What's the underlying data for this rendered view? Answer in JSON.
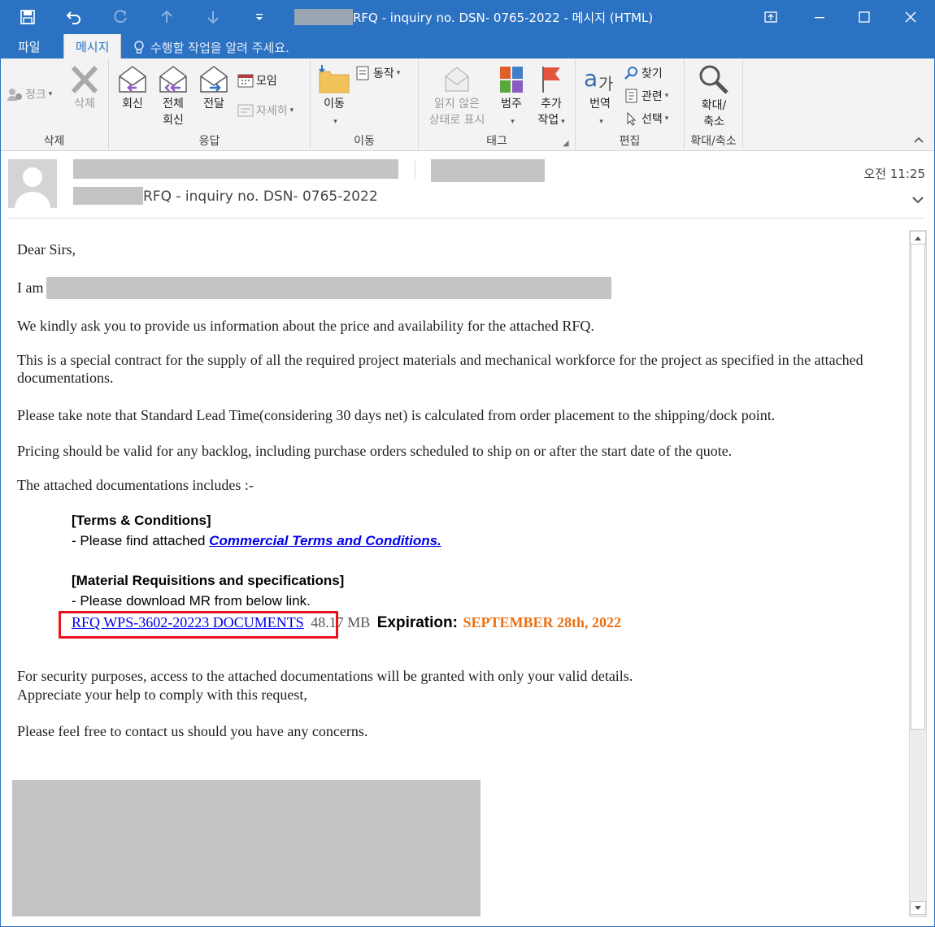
{
  "window": {
    "title": "RFQ - inquiry no. DSN- 0765-2022 - 메시지 (HTML)"
  },
  "tabs": [
    {
      "label": "파일"
    },
    {
      "label": "메시지",
      "active": true
    }
  ],
  "tell_me": {
    "placeholder": "수행할 작업을 알려 주세요."
  },
  "ribbon": {
    "delete_group": {
      "label": "삭제",
      "junk": "정크",
      "delete": "삭제"
    },
    "respond_group": {
      "label": "응답",
      "reply": "회신",
      "reply_all_1": "전체",
      "reply_all_2": "회신",
      "forward": "전달",
      "meeting": "모임",
      "more": "자세히"
    },
    "move_group": {
      "label": "이동",
      "move": "이동",
      "actions": "동작"
    },
    "tags_group": {
      "label": "태그",
      "unread_1": "읽지 않은",
      "unread_2": "상태로 표시",
      "categorize": "범주",
      "followup_1": "추가",
      "followup_2": "작업"
    },
    "edit_group": {
      "label": "편집",
      "translate": "번역",
      "find": "찾기",
      "related": "관련",
      "select": "선택"
    },
    "zoom_group": {
      "label": "확대/축소",
      "zoom_1": "확대/",
      "zoom_2": "축소"
    }
  },
  "header": {
    "subject": "RFQ - inquiry no. DSN- 0765-2022",
    "time": "오전 11:25"
  },
  "body": {
    "greeting": "Dear Sirs,",
    "intro": "I am",
    "p1": "We kindly ask you to provide us information about the price and availability for the attached RFQ.",
    "p2": "This is a special contract for the supply of all the required project materials and mechanical workforce for the project as specified in the attached documentations.",
    "p3": "Please take note that Standard Lead Time(considering 30 days net) is calculated from order placement to the shipping/dock point.",
    "p4": "Pricing should be valid for any backlog, including purchase orders scheduled to ship on or after the start date of the quote.",
    "p5": "The attached documentations includes :-",
    "terms_heading": "[Terms & Conditions]",
    "terms_prefix": "- Please find attached ",
    "terms_link": "Commercial Terms and Conditions.",
    "mr_heading": "[Material Requisitions and specifications]",
    "mr_text": "- Please download MR from below link.",
    "doc_link": "RFQ WPS-3602-20223 DOCUMENTS",
    "doc_size": "48.17 MB",
    "expiration_label": "Expiration:",
    "expiration_date": "SEPTEMBER 28th, 2022",
    "p6": "For security purposes, access to the attached documentations will be granted with only your valid details.",
    "p7": "Appreciate your help to comply with this request,",
    "p8": "Please feel free to contact us should you have any concerns."
  },
  "colors": {
    "titlebar": "#2b72c3",
    "highlight_box": "#e8141d",
    "link": "#0000ee",
    "expiration": "#ed7014"
  }
}
